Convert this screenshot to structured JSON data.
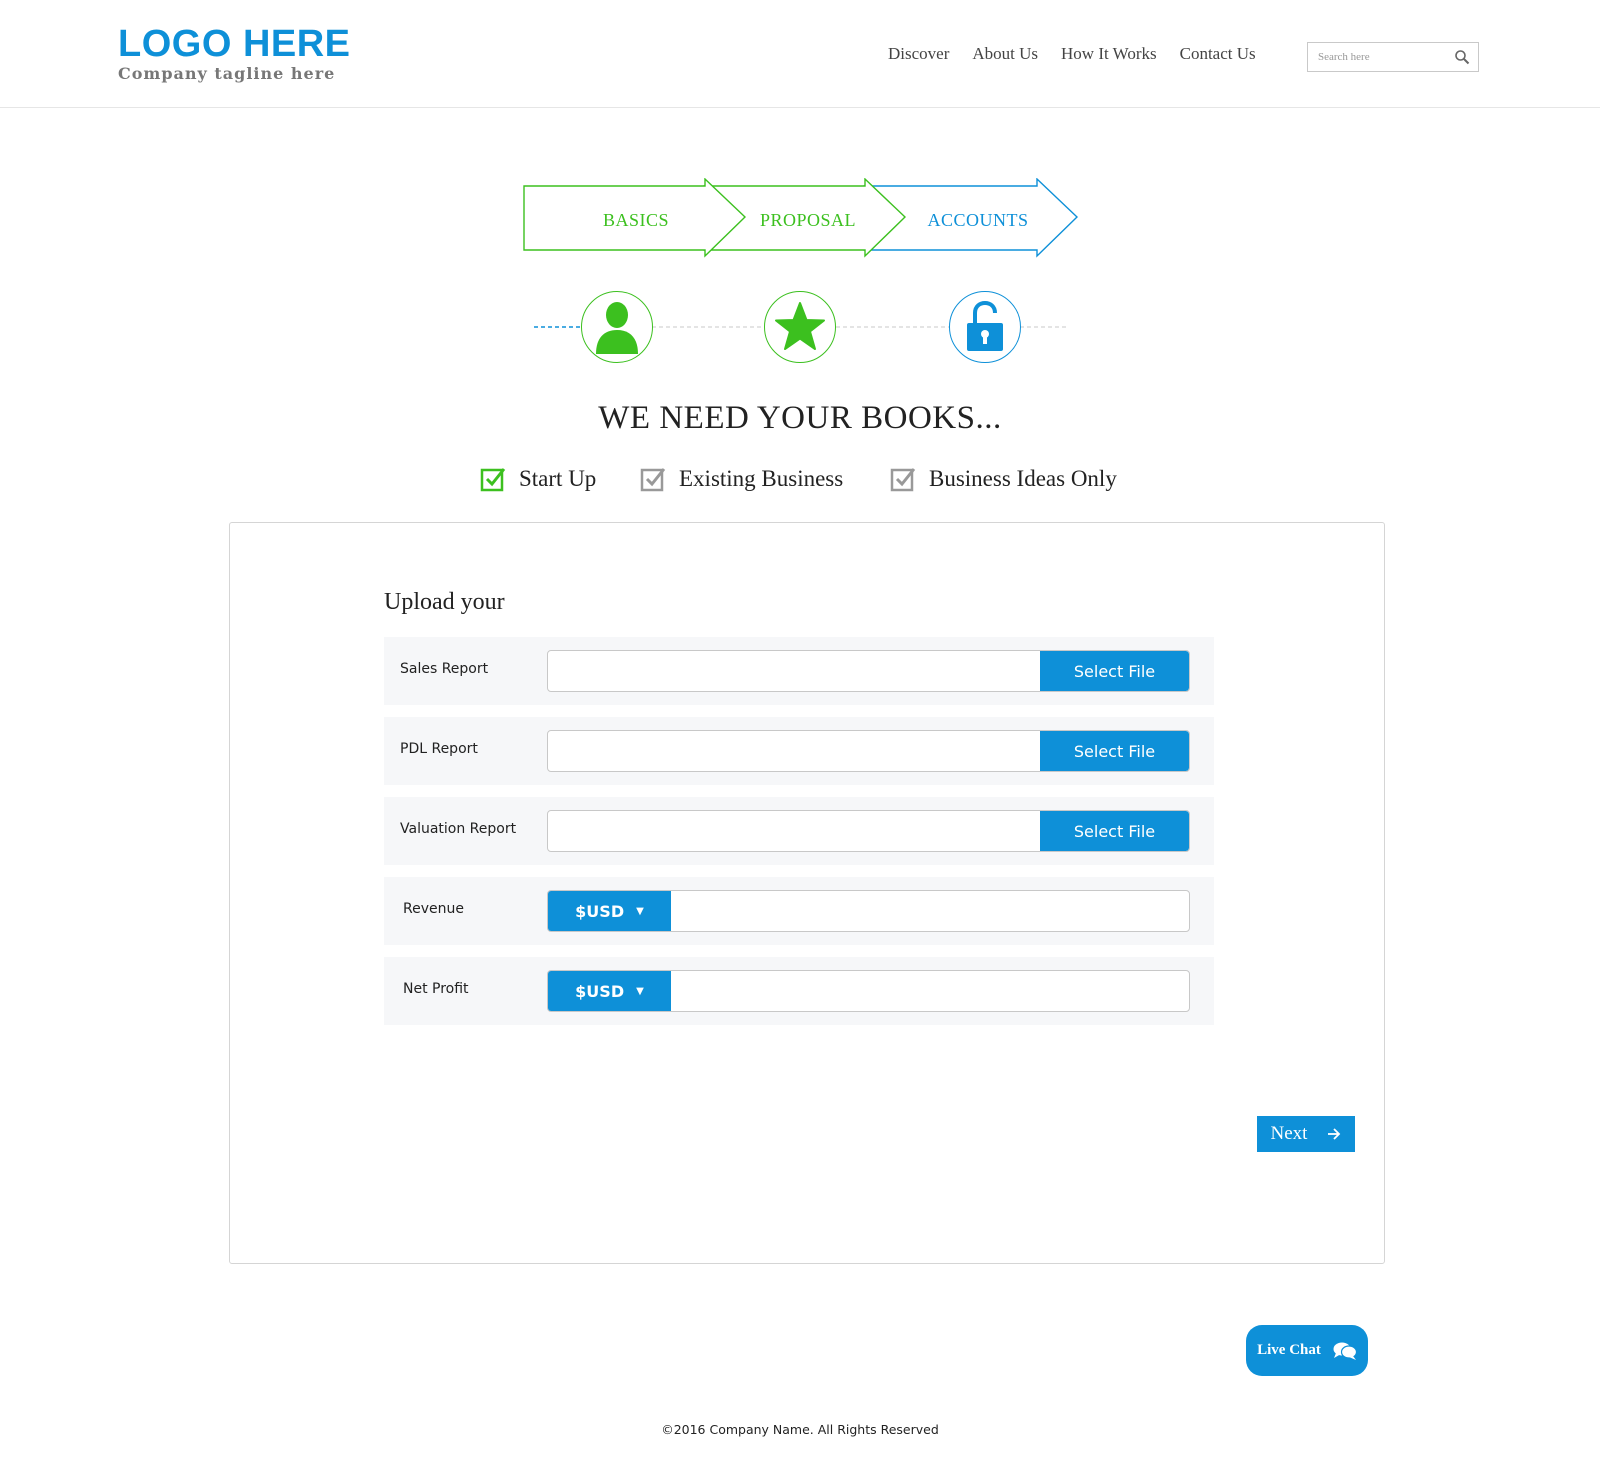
{
  "header": {
    "logo": "LOGO HERE",
    "tagline": "Company tagline here",
    "nav": [
      "Discover",
      "About Us",
      "How It Works",
      "Contact Us"
    ],
    "search": {
      "placeholder": "Search here",
      "icon": "search-icon"
    }
  },
  "steps": [
    {
      "label": "BASICS",
      "icon": "user-icon",
      "color": "#3cc01f"
    },
    {
      "label": "PROPOSAL",
      "icon": "star-icon",
      "color": "#3cc01f"
    },
    {
      "label": "ACCOUNTS",
      "icon": "unlock-icon",
      "color": "#0e90d8"
    }
  ],
  "heading": "WE NEED YOUR BOOKS...",
  "business_types": [
    {
      "label": "Start Up",
      "checked_color": "#3cc01f",
      "icon": "checkbox-checked-icon"
    },
    {
      "label": "Existing Business",
      "checked_color": "#999999",
      "icon": "checkbox-icon"
    },
    {
      "label": "Business Ideas Only",
      "checked_color": "#999999",
      "icon": "checkbox-icon"
    }
  ],
  "form": {
    "title": "Upload your",
    "file_rows": [
      {
        "label": "Sales Report",
        "button": "Select File",
        "value": ""
      },
      {
        "label": "PDL Report",
        "button": "Select File",
        "value": ""
      },
      {
        "label": "Valuation Report",
        "button": "Select File",
        "value": ""
      }
    ],
    "money_rows": [
      {
        "label": "Revenue",
        "currency": "$USD",
        "value": ""
      },
      {
        "label": "Net Profit",
        "currency": "$USD",
        "value": ""
      }
    ],
    "next": "Next"
  },
  "live_chat": "Live Chat",
  "footer": "©2016 Company Name. All Rights Reserved",
  "colors": {
    "accent": "#0e90d8",
    "green": "#3cc01f"
  }
}
